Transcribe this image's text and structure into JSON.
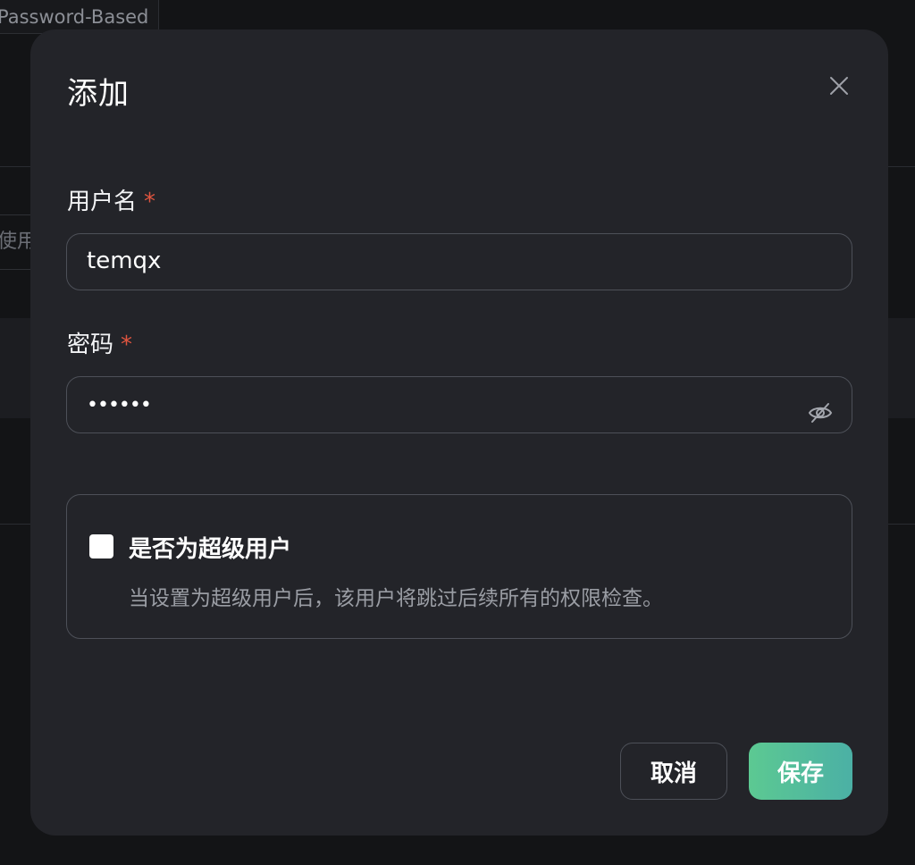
{
  "background": {
    "tab_label": "Password-Based",
    "input_fragment": "使用"
  },
  "dialog": {
    "title": "添加",
    "close_icon": "close-icon",
    "username": {
      "label": "用户名",
      "required_mark": "*",
      "value": "temqx"
    },
    "password": {
      "label": "密码",
      "required_mark": "*",
      "masked_value": "••••••",
      "toggle_icon": "eye-slash-icon"
    },
    "superuser": {
      "checked": false,
      "label": "是否为超级用户",
      "description": "当设置为超级用户后，该用户将跳过后续所有的权限检查。"
    },
    "buttons": {
      "cancel": "取消",
      "save": "保存"
    }
  },
  "colors": {
    "required": "#e0553f",
    "save_gradient_start": "#5cc992",
    "save_gradient_end": "#4bb0a5",
    "dialog_bg": "#232429"
  }
}
